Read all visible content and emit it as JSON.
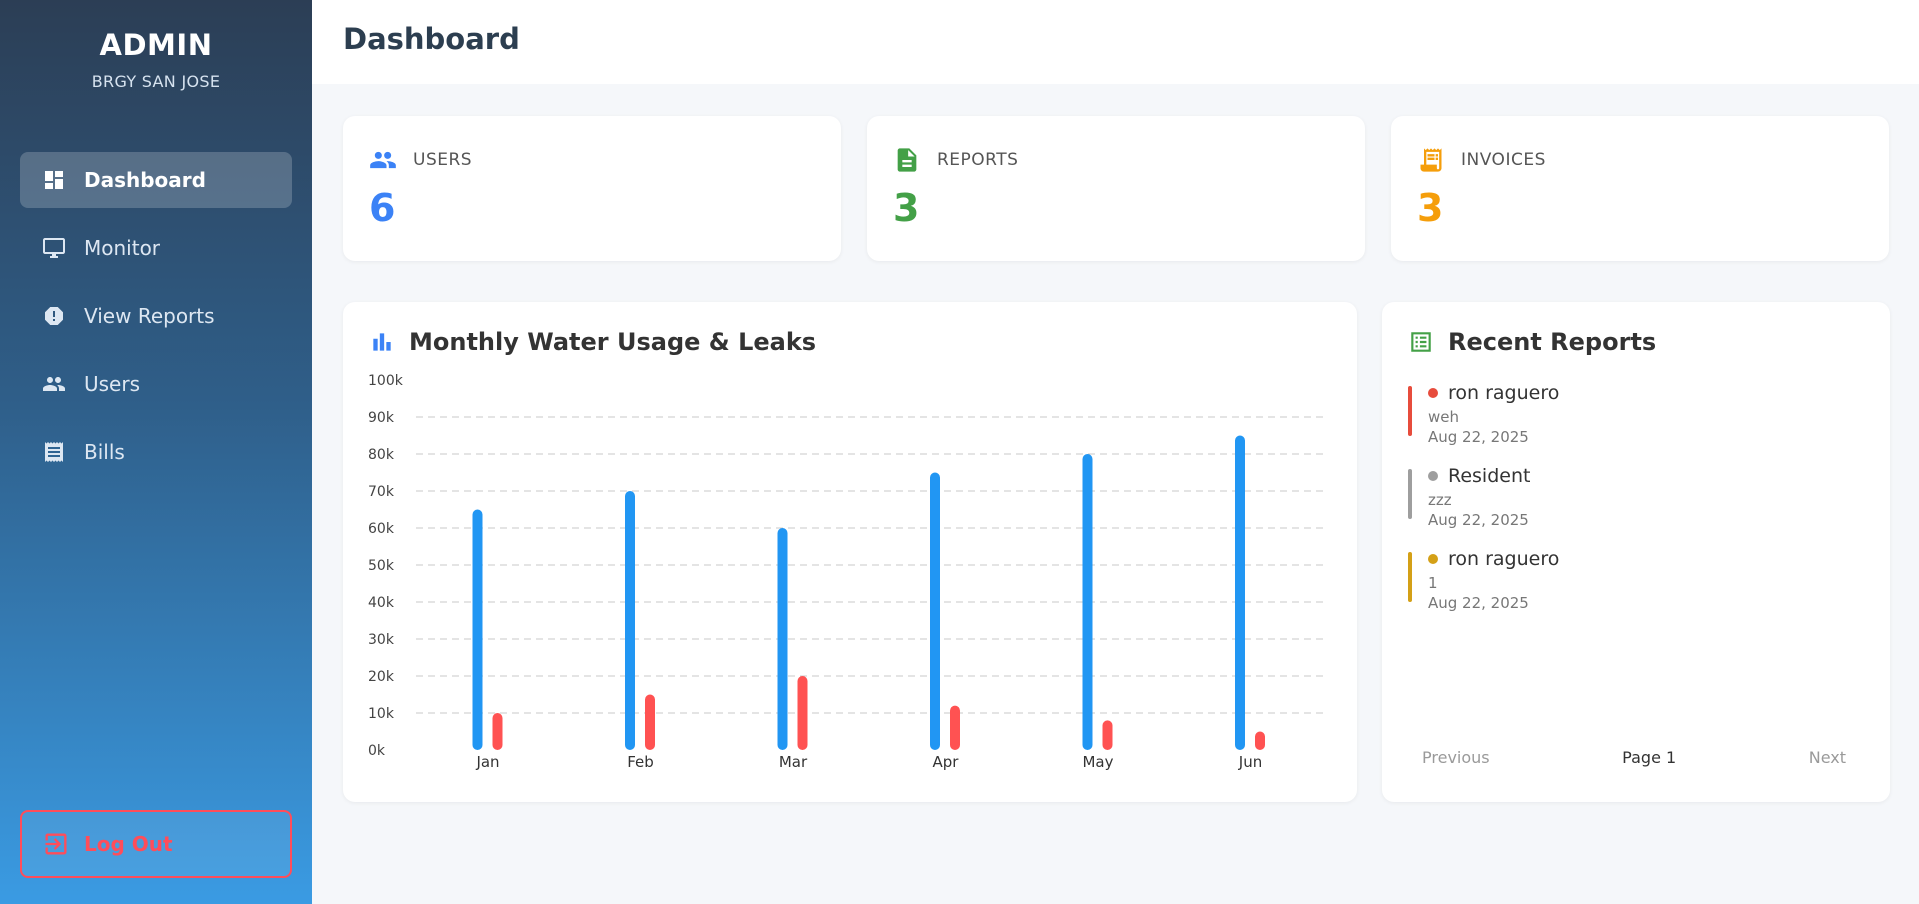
{
  "sidebar": {
    "title": "ADMIN",
    "subtitle": "BRGY SAN JOSE",
    "items": [
      {
        "label": "Dashboard",
        "icon": "dashboard-icon",
        "active": true
      },
      {
        "label": "Monitor",
        "icon": "monitor-icon"
      },
      {
        "label": "View Reports",
        "icon": "alert-icon"
      },
      {
        "label": "Users",
        "icon": "users-icon"
      },
      {
        "label": "Bills",
        "icon": "receipt-icon"
      }
    ],
    "logout_label": "Log Out"
  },
  "header": {
    "title": "Dashboard"
  },
  "stats": [
    {
      "label": "USERS",
      "value": "6",
      "color": "#3b82f6",
      "icon": "users-icon"
    },
    {
      "label": "REPORTS",
      "value": "3",
      "color": "#43a047",
      "icon": "document-icon"
    },
    {
      "label": "INVOICES",
      "value": "3",
      "color": "#f59e0b",
      "icon": "invoice-icon"
    }
  ],
  "chart": {
    "title": "Monthly Water Usage & Leaks"
  },
  "chart_data": {
    "type": "bar",
    "categories": [
      "Jan",
      "Feb",
      "Mar",
      "Apr",
      "May",
      "Jun"
    ],
    "series": [
      {
        "values": [
          65000,
          70000,
          60000,
          75000,
          80000,
          85000
        ],
        "color": "#2196f3"
      },
      {
        "values": [
          10000,
          15000,
          20000,
          12000,
          8000,
          5000
        ],
        "color": "#ff5252"
      }
    ],
    "ylim": [
      0,
      100000
    ],
    "yticks": [
      "0k",
      "10k",
      "20k",
      "30k",
      "40k",
      "50k",
      "60k",
      "70k",
      "80k",
      "90k",
      "100k"
    ],
    "grid": true
  },
  "reports": {
    "title": "Recent Reports",
    "items": [
      {
        "name": "ron raguero",
        "message": "weh",
        "date": "Aug 22, 2025",
        "color": "#e74c3c"
      },
      {
        "name": "Resident",
        "message": "zzz",
        "date": "Aug 22, 2025",
        "color": "#9e9e9e"
      },
      {
        "name": "ron raguero",
        "message": "1",
        "date": "Aug 22, 2025",
        "color": "#d4a017"
      }
    ],
    "pager": {
      "previous": "Previous",
      "page": "Page 1",
      "next": "Next"
    }
  }
}
